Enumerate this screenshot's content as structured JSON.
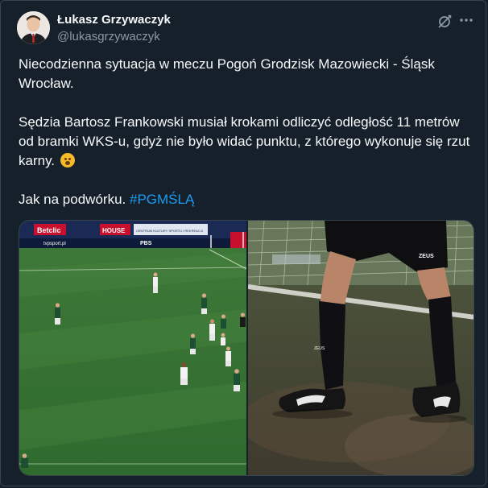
{
  "author": {
    "name": "Łukasz Grzywaczyk",
    "handle": "@lukasgrzywaczyk"
  },
  "tweet": {
    "line1": "Niecodzienna sytuacja w meczu Pogoń Grodzisk Mazowiecki - Śląsk Wrocław.",
    "line2": "Sędzia Bartosz Frankowski musiał krokami odliczyć odległość 11 metrów od bramki WKS-u, gdyż nie było widać punktu, z którego wykonuje się rzut karny.",
    "line3": "Jak na podwórku.",
    "hashtag": "#PGMŚLĄ",
    "emoji": "flushed-face-emoji"
  },
  "media": {
    "left_ads": {
      "ad1": "Betclic",
      "ad2": "HOUSE",
      "ad3": "CENTRUM KULTURY SPORTU I REKREACJI",
      "ad4": "tvpsport.pl",
      "ad5": "PBS"
    },
    "right_overlay": {
      "sock_logo": "ZEUS",
      "shorts_logo": "ZEUS"
    }
  },
  "icons": {
    "grok": "grok-icon",
    "more": "more-icon"
  }
}
